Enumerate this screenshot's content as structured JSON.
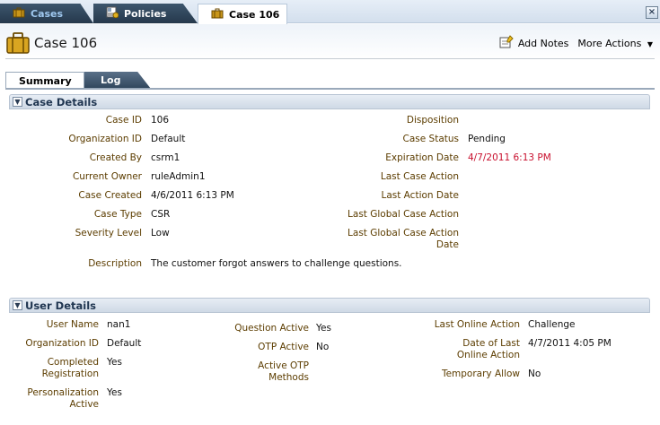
{
  "top_tabs": [
    {
      "label": "Cases",
      "icon": "briefcase-icon"
    },
    {
      "label": "Policies",
      "icon": "policy-icon"
    },
    {
      "label": "Case 106",
      "icon": "briefcase-icon"
    }
  ],
  "header": {
    "title": "Case 106",
    "add_notes": "Add Notes",
    "more_actions": "More Actions"
  },
  "sub_tabs": [
    {
      "label": "Summary"
    },
    {
      "label": "Log"
    }
  ],
  "case_details": {
    "title": "Case Details",
    "left": [
      {
        "label": "Case ID",
        "value": "106"
      },
      {
        "label": "Organization ID",
        "value": "Default"
      },
      {
        "label": "Created By",
        "value": "csrm1"
      },
      {
        "label": "Current Owner",
        "value": "ruleAdmin1"
      },
      {
        "label": "Case Created",
        "value": "4/6/2011 6:13 PM"
      },
      {
        "label": "Case Type",
        "value": "CSR"
      },
      {
        "label": "Severity Level",
        "value": "Low"
      }
    ],
    "right": [
      {
        "label": "Disposition",
        "value": ""
      },
      {
        "label": "Case Status",
        "value": "Pending"
      },
      {
        "label": "Expiration Date",
        "value": "4/7/2011 6:13 PM"
      },
      {
        "label": "Last Case Action",
        "value": ""
      },
      {
        "label": "Last Action Date",
        "value": ""
      },
      {
        "label": "Last Global Case Action",
        "value": ""
      },
      {
        "label_line1": "Last Global Case Action",
        "label_line2": "Date",
        "value": ""
      }
    ],
    "description": {
      "label": "Description",
      "value": "The customer forgot answers to challenge questions."
    }
  },
  "user_details": {
    "title": "User Details",
    "col1": [
      {
        "label": "User Name",
        "value": "nan1"
      },
      {
        "label": "Organization ID",
        "value": "Default"
      },
      {
        "label_line1": "Completed",
        "label_line2": "Registration",
        "value": "Yes"
      },
      {
        "label_line1": "Personalization",
        "label_line2": "Active",
        "value": "Yes"
      }
    ],
    "col2": [
      {
        "label": "Question Active",
        "value": "Yes"
      },
      {
        "label": "OTP Active",
        "value": "No"
      },
      {
        "label_line1": "Active OTP",
        "label_line2": "Methods",
        "value": ""
      }
    ],
    "col3": [
      {
        "label": "Last Online Action",
        "value": "Challenge"
      },
      {
        "label_line1": "Date of Last",
        "label_line2": "Online Action",
        "value": "4/7/2011 4:05 PM"
      },
      {
        "label": "Temporary Allow",
        "value": "No"
      }
    ]
  },
  "colors": {
    "expiration_value": "#c8102e",
    "label": "#5c3d00",
    "header_text": "#1f3550"
  }
}
